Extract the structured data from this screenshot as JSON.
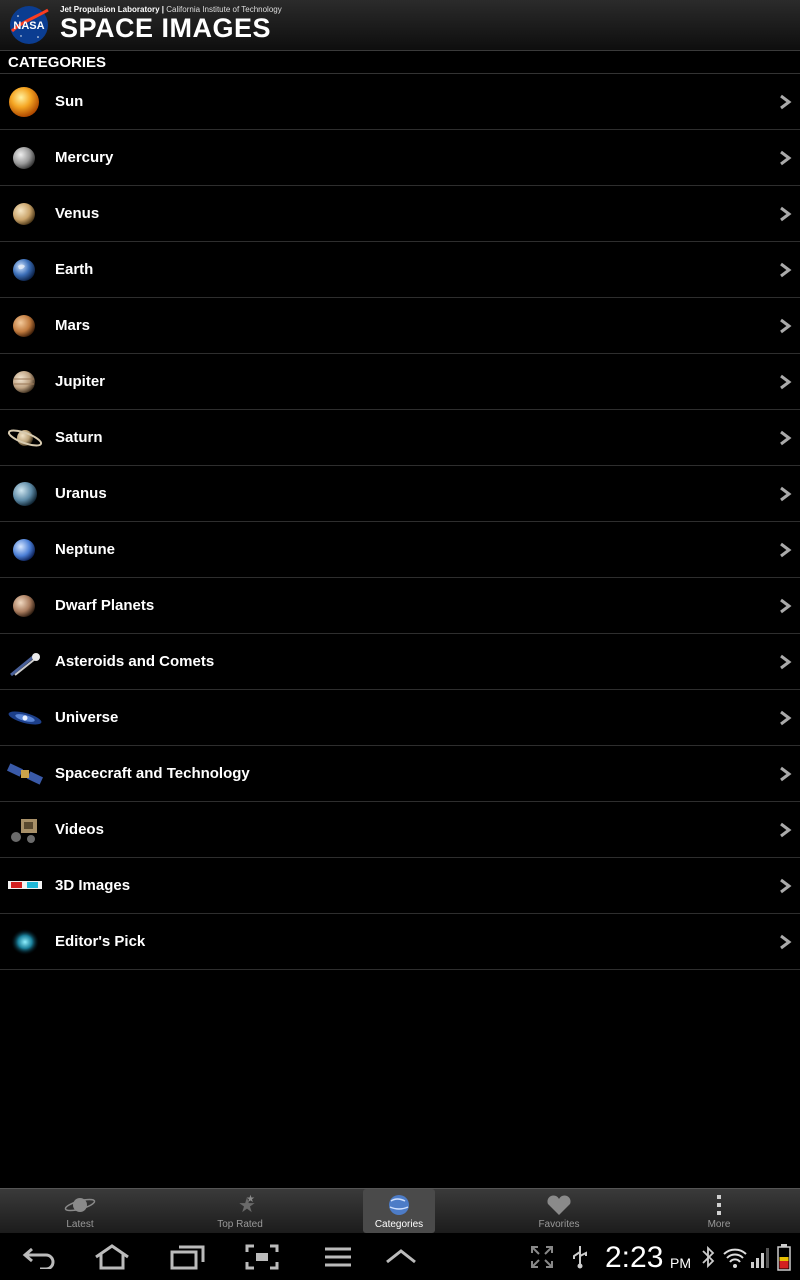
{
  "header": {
    "org_primary": "Jet Propulsion Laboratory |",
    "org_secondary": " California Institute of Technology",
    "title": "SPACE IMAGES",
    "logo_text": "NASA"
  },
  "section": {
    "title": "CATEGORIES"
  },
  "categories": [
    {
      "label": "Sun",
      "icon": "sun-icon"
    },
    {
      "label": "Mercury",
      "icon": "mercury-icon"
    },
    {
      "label": "Venus",
      "icon": "venus-icon"
    },
    {
      "label": "Earth",
      "icon": "earth-icon"
    },
    {
      "label": "Mars",
      "icon": "mars-icon"
    },
    {
      "label": "Jupiter",
      "icon": "jupiter-icon"
    },
    {
      "label": "Saturn",
      "icon": "saturn-icon"
    },
    {
      "label": "Uranus",
      "icon": "uranus-icon"
    },
    {
      "label": "Neptune",
      "icon": "neptune-icon"
    },
    {
      "label": "Dwarf Planets",
      "icon": "dwarf-planet-icon"
    },
    {
      "label": "Asteroids and Comets",
      "icon": "comet-icon"
    },
    {
      "label": "Universe",
      "icon": "galaxy-icon"
    },
    {
      "label": "Spacecraft and Technology",
      "icon": "satellite-icon"
    },
    {
      "label": "Videos",
      "icon": "rover-icon"
    },
    {
      "label": "3D Images",
      "icon": "3d-glasses-icon"
    },
    {
      "label": "Editor's Pick",
      "icon": "nebula-icon"
    }
  ],
  "tabs": [
    {
      "label": "Latest",
      "icon": "planet-icon",
      "active": false
    },
    {
      "label": "Top Rated",
      "icon": "stars-icon",
      "active": false
    },
    {
      "label": "Categories",
      "icon": "globe-icon",
      "active": true
    },
    {
      "label": "Favorites",
      "icon": "heart-icon",
      "active": false
    },
    {
      "label": "More",
      "icon": "more-vertical-icon",
      "active": false
    }
  ],
  "system": {
    "time": "2:23",
    "ampm": "PM"
  },
  "colors": {
    "background": "#000000",
    "text": "#ffffff",
    "divider": "#2e2e2e",
    "tab_inactive": "#999999"
  }
}
